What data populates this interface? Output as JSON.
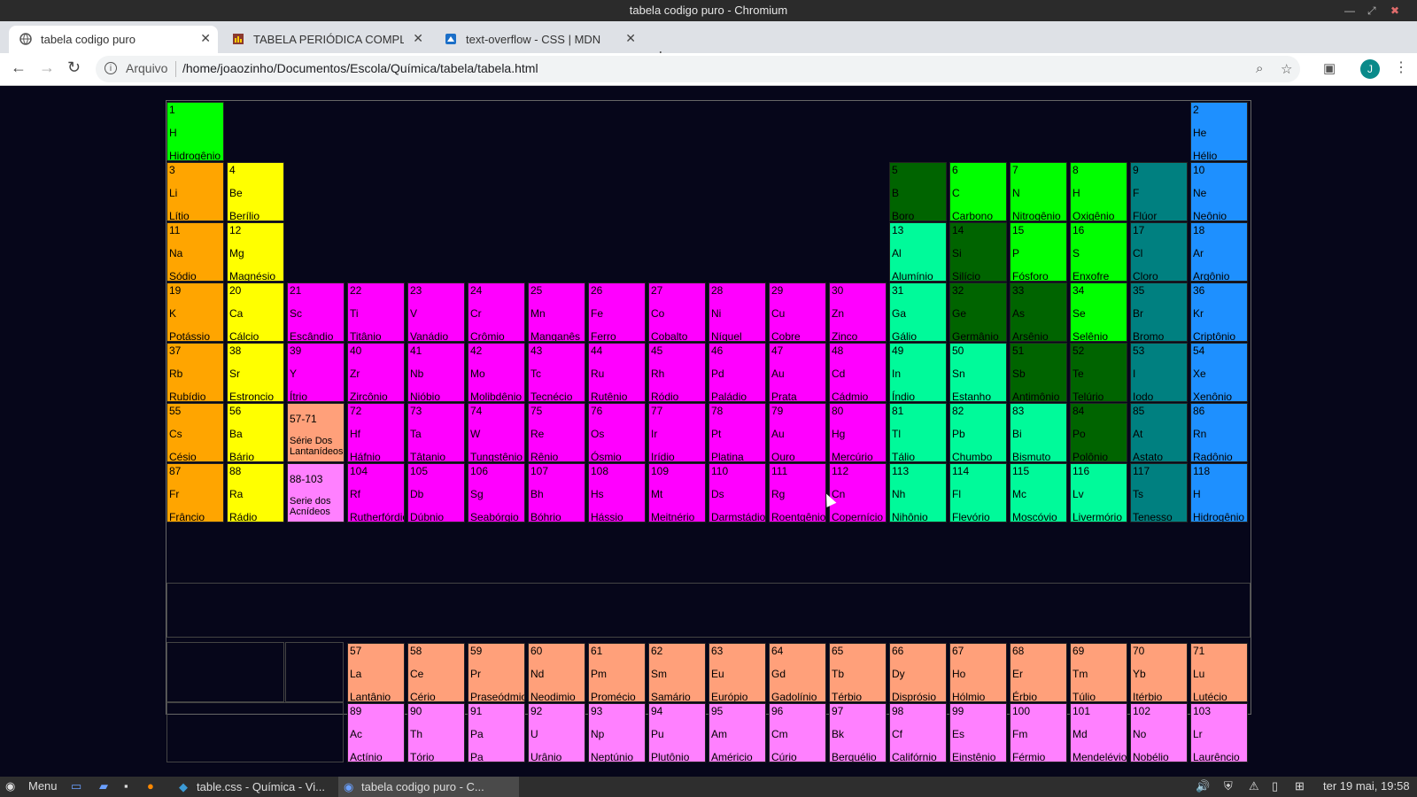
{
  "window": {
    "title": "tabela codigo puro - Chromium"
  },
  "tabs": [
    {
      "label": "tabela codigo puro",
      "icon": "globe-icon",
      "active": true
    },
    {
      "label": "TABELA PERIÓDICA COMPLET",
      "icon": "chart-icon",
      "active": false
    },
    {
      "label": "text-overflow - CSS | MDN",
      "icon": "mdn-icon",
      "active": false
    }
  ],
  "toolbar": {
    "origin": "Arquivo",
    "url": "/home/joaozinho/Documentos/Escola/Química/tabela/tabela.html",
    "avatar": "J"
  },
  "colors": {
    "alkali": "#ffa500",
    "alkaline": "#ffff00",
    "transition": "#ff00ff",
    "nonmetal": "#00ff00",
    "metalloid": "#006400",
    "poormetal": "#00fa9a",
    "halogen": "#008080",
    "noble": "#1e90ff",
    "lanthanide": "#ffa07a",
    "actinide": "#ff80ff",
    "hydrogen": "#00ff00"
  },
  "elements": [
    {
      "n": "1",
      "s": "H",
      "name": "Hidrogênio",
      "c": "nonmetal",
      "r": 1,
      "col": 1
    },
    {
      "n": "2",
      "s": "He",
      "name": "Hélio",
      "c": "noble",
      "r": 1,
      "col": 18
    },
    {
      "n": "3",
      "s": "Li",
      "name": "Lítio",
      "c": "alkali",
      "r": 2,
      "col": 1
    },
    {
      "n": "4",
      "s": "Be",
      "name": "Berílio",
      "c": "alkaline",
      "r": 2,
      "col": 2
    },
    {
      "n": "5",
      "s": "B",
      "name": "Boro",
      "c": "metalloid",
      "r": 2,
      "col": 13
    },
    {
      "n": "6",
      "s": "C",
      "name": "Carbono",
      "c": "nonmetal",
      "r": 2,
      "col": 14
    },
    {
      "n": "7",
      "s": "N",
      "name": "Nitrogênio",
      "c": "nonmetal",
      "r": 2,
      "col": 15
    },
    {
      "n": "8",
      "s": "H",
      "name": "Oxigênio",
      "c": "nonmetal",
      "r": 2,
      "col": 16
    },
    {
      "n": "9",
      "s": "F",
      "name": "Flúor",
      "c": "halogen",
      "r": 2,
      "col": 17
    },
    {
      "n": "10",
      "s": "Ne",
      "name": "Neônio",
      "c": "noble",
      "r": 2,
      "col": 18
    },
    {
      "n": "11",
      "s": "Na",
      "name": "Sódio",
      "c": "alkali",
      "r": 3,
      "col": 1
    },
    {
      "n": "12",
      "s": "Mg",
      "name": "Magnésio",
      "c": "alkaline",
      "r": 3,
      "col": 2
    },
    {
      "n": "13",
      "s": "Al",
      "name": "Alumínio",
      "c": "poormetal",
      "r": 3,
      "col": 13
    },
    {
      "n": "14",
      "s": "Si",
      "name": "Silício",
      "c": "metalloid",
      "r": 3,
      "col": 14
    },
    {
      "n": "15",
      "s": "P",
      "name": "Fósforo",
      "c": "nonmetal",
      "r": 3,
      "col": 15
    },
    {
      "n": "16",
      "s": "S",
      "name": "Enxofre",
      "c": "nonmetal",
      "r": 3,
      "col": 16
    },
    {
      "n": "17",
      "s": "Cl",
      "name": "Cloro",
      "c": "halogen",
      "r": 3,
      "col": 17
    },
    {
      "n": "18",
      "s": "Ar",
      "name": "Argônio",
      "c": "noble",
      "r": 3,
      "col": 18
    },
    {
      "n": "19",
      "s": "K",
      "name": "Potássio",
      "c": "alkali",
      "r": 4,
      "col": 1
    },
    {
      "n": "20",
      "s": "Ca",
      "name": "Cálcio",
      "c": "alkaline",
      "r": 4,
      "col": 2
    },
    {
      "n": "21",
      "s": "Sc",
      "name": "Escândio",
      "c": "transition",
      "r": 4,
      "col": 3
    },
    {
      "n": "22",
      "s": "Ti",
      "name": "Titânio",
      "c": "transition",
      "r": 4,
      "col": 4
    },
    {
      "n": "23",
      "s": "V",
      "name": "Vanádio",
      "c": "transition",
      "r": 4,
      "col": 5
    },
    {
      "n": "24",
      "s": "Cr",
      "name": "Crômio",
      "c": "transition",
      "r": 4,
      "col": 6
    },
    {
      "n": "25",
      "s": "Mn",
      "name": "Manganês",
      "c": "transition",
      "r": 4,
      "col": 7
    },
    {
      "n": "26",
      "s": "Fe",
      "name": "Ferro",
      "c": "transition",
      "r": 4,
      "col": 8
    },
    {
      "n": "27",
      "s": "Co",
      "name": "Cobalto",
      "c": "transition",
      "r": 4,
      "col": 9
    },
    {
      "n": "28",
      "s": "Ni",
      "name": "Níquel",
      "c": "transition",
      "r": 4,
      "col": 10
    },
    {
      "n": "29",
      "s": "Cu",
      "name": "Cobre",
      "c": "transition",
      "r": 4,
      "col": 11
    },
    {
      "n": "30",
      "s": "Zn",
      "name": "Zinco",
      "c": "transition",
      "r": 4,
      "col": 12
    },
    {
      "n": "31",
      "s": "Ga",
      "name": "Gálio",
      "c": "poormetal",
      "r": 4,
      "col": 13
    },
    {
      "n": "32",
      "s": "Ge",
      "name": "Germânio",
      "c": "metalloid",
      "r": 4,
      "col": 14
    },
    {
      "n": "33",
      "s": "As",
      "name": "Arsênio",
      "c": "metalloid",
      "r": 4,
      "col": 15
    },
    {
      "n": "34",
      "s": "Se",
      "name": "Selênio",
      "c": "nonmetal",
      "r": 4,
      "col": 16
    },
    {
      "n": "35",
      "s": "Br",
      "name": "Bromo",
      "c": "halogen",
      "r": 4,
      "col": 17
    },
    {
      "n": "36",
      "s": "Kr",
      "name": "Criptônio",
      "c": "noble",
      "r": 4,
      "col": 18
    },
    {
      "n": "37",
      "s": "Rb",
      "name": "Rubídio",
      "c": "alkali",
      "r": 5,
      "col": 1
    },
    {
      "n": "38",
      "s": "Sr",
      "name": "Estroncio",
      "c": "alkaline",
      "r": 5,
      "col": 2
    },
    {
      "n": "39",
      "s": "Y",
      "name": "Ítrio",
      "c": "transition",
      "r": 5,
      "col": 3
    },
    {
      "n": "40",
      "s": "Zr",
      "name": "Zircônio",
      "c": "transition",
      "r": 5,
      "col": 4
    },
    {
      "n": "41",
      "s": "Nb",
      "name": "Nióbio",
      "c": "transition",
      "r": 5,
      "col": 5
    },
    {
      "n": "42",
      "s": "Mo",
      "name": "Molibdênio",
      "c": "transition",
      "r": 5,
      "col": 6
    },
    {
      "n": "43",
      "s": "Tc",
      "name": "Tecnécio",
      "c": "transition",
      "r": 5,
      "col": 7
    },
    {
      "n": "44",
      "s": "Ru",
      "name": "Rutênio",
      "c": "transition",
      "r": 5,
      "col": 8
    },
    {
      "n": "45",
      "s": "Rh",
      "name": "Ródio",
      "c": "transition",
      "r": 5,
      "col": 9
    },
    {
      "n": "46",
      "s": "Pd",
      "name": "Paládio",
      "c": "transition",
      "r": 5,
      "col": 10
    },
    {
      "n": "47",
      "s": "Au",
      "name": "Prata",
      "c": "transition",
      "r": 5,
      "col": 11
    },
    {
      "n": "48",
      "s": "Cd",
      "name": "Cádmio",
      "c": "transition",
      "r": 5,
      "col": 12
    },
    {
      "n": "49",
      "s": "In",
      "name": "Índio",
      "c": "poormetal",
      "r": 5,
      "col": 13
    },
    {
      "n": "50",
      "s": "Sn",
      "name": "Estanho",
      "c": "poormetal",
      "r": 5,
      "col": 14
    },
    {
      "n": "51",
      "s": "Sb",
      "name": "Antimônio",
      "c": "metalloid",
      "r": 5,
      "col": 15
    },
    {
      "n": "52",
      "s": "Te",
      "name": "Telúrio",
      "c": "metalloid",
      "r": 5,
      "col": 16
    },
    {
      "n": "53",
      "s": "I",
      "name": "Iodo",
      "c": "halogen",
      "r": 5,
      "col": 17
    },
    {
      "n": "54",
      "s": "Xe",
      "name": "Xenônio",
      "c": "noble",
      "r": 5,
      "col": 18
    },
    {
      "n": "55",
      "s": "Cs",
      "name": "Césio",
      "c": "alkali",
      "r": 6,
      "col": 1
    },
    {
      "n": "56",
      "s": "Ba",
      "name": "Bário",
      "c": "alkaline",
      "r": 6,
      "col": 2
    },
    {
      "n": "57-71",
      "s": "",
      "name": "Série Dos Lantanídeos",
      "c": "lanthanide",
      "r": 6,
      "col": 3,
      "series": true
    },
    {
      "n": "72",
      "s": "Hf",
      "name": "Háfnio",
      "c": "transition",
      "r": 6,
      "col": 4
    },
    {
      "n": "73",
      "s": "Ta",
      "name": "Tâtanio",
      "c": "transition",
      "r": 6,
      "col": 5
    },
    {
      "n": "74",
      "s": "W",
      "name": "Tungstênio",
      "c": "transition",
      "r": 6,
      "col": 6
    },
    {
      "n": "75",
      "s": "Re",
      "name": "Rênio",
      "c": "transition",
      "r": 6,
      "col": 7
    },
    {
      "n": "76",
      "s": "Os",
      "name": "Ósmio",
      "c": "transition",
      "r": 6,
      "col": 8
    },
    {
      "n": "77",
      "s": "Ir",
      "name": "Irídio",
      "c": "transition",
      "r": 6,
      "col": 9
    },
    {
      "n": "78",
      "s": "Pt",
      "name": "Platina",
      "c": "transition",
      "r": 6,
      "col": 10
    },
    {
      "n": "79",
      "s": "Au",
      "name": "Ouro",
      "c": "transition",
      "r": 6,
      "col": 11
    },
    {
      "n": "80",
      "s": "Hg",
      "name": "Mercúrio",
      "c": "transition",
      "r": 6,
      "col": 12
    },
    {
      "n": "81",
      "s": "Tl",
      "name": "Tálio",
      "c": "poormetal",
      "r": 6,
      "col": 13
    },
    {
      "n": "82",
      "s": "Pb",
      "name": "Chumbo",
      "c": "poormetal",
      "r": 6,
      "col": 14
    },
    {
      "n": "83",
      "s": "Bi",
      "name": "Bismuto",
      "c": "poormetal",
      "r": 6,
      "col": 15
    },
    {
      "n": "84",
      "s": "Po",
      "name": "Polônio",
      "c": "metalloid",
      "r": 6,
      "col": 16
    },
    {
      "n": "85",
      "s": "At",
      "name": "Astato",
      "c": "halogen",
      "r": 6,
      "col": 17
    },
    {
      "n": "86",
      "s": "Rn",
      "name": "Radônio",
      "c": "noble",
      "r": 6,
      "col": 18
    },
    {
      "n": "87",
      "s": "Fr",
      "name": "Frâncio",
      "c": "alkali",
      "r": 7,
      "col": 1
    },
    {
      "n": "88",
      "s": "Ra",
      "name": "Rádio",
      "c": "alkaline",
      "r": 7,
      "col": 2
    },
    {
      "n": "88-103",
      "s": "",
      "name": "Serie dos Acnídeos",
      "c": "actinide",
      "r": 7,
      "col": 3,
      "series": true
    },
    {
      "n": "104",
      "s": "Rf",
      "name": "Rutherfórdio",
      "c": "transition",
      "r": 7,
      "col": 4
    },
    {
      "n": "105",
      "s": "Db",
      "name": "Dúbnio",
      "c": "transition",
      "r": 7,
      "col": 5
    },
    {
      "n": "106",
      "s": "Sg",
      "name": "Seabórgio",
      "c": "transition",
      "r": 7,
      "col": 6
    },
    {
      "n": "107",
      "s": "Bh",
      "name": "Bóhrio",
      "c": "transition",
      "r": 7,
      "col": 7
    },
    {
      "n": "108",
      "s": "Hs",
      "name": "Hássio",
      "c": "transition",
      "r": 7,
      "col": 8
    },
    {
      "n": "109",
      "s": "Mt",
      "name": "Meitnério",
      "c": "transition",
      "r": 7,
      "col": 9
    },
    {
      "n": "110",
      "s": "Ds",
      "name": "Darmstádio",
      "c": "transition",
      "r": 7,
      "col": 10
    },
    {
      "n": "111",
      "s": "Rg",
      "name": "Roentgênio",
      "c": "transition",
      "r": 7,
      "col": 11
    },
    {
      "n": "112",
      "s": "Cn",
      "name": "Copernício",
      "c": "transition",
      "r": 7,
      "col": 12
    },
    {
      "n": "113",
      "s": "Nh",
      "name": "Nihônio",
      "c": "poormetal",
      "r": 7,
      "col": 13
    },
    {
      "n": "114",
      "s": "Fl",
      "name": "Flevório",
      "c": "poormetal",
      "r": 7,
      "col": 14
    },
    {
      "n": "115",
      "s": "Mc",
      "name": "Moscóvio",
      "c": "poormetal",
      "r": 7,
      "col": 15
    },
    {
      "n": "116",
      "s": "Lv",
      "name": "Livermório",
      "c": "poormetal",
      "r": 7,
      "col": 16
    },
    {
      "n": "117",
      "s": "Ts",
      "name": "Tenesso",
      "c": "halogen",
      "r": 7,
      "col": 17
    },
    {
      "n": "118",
      "s": "H",
      "name": "Hidrogênio",
      "c": "noble",
      "r": 7,
      "col": 18
    },
    {
      "n": "57",
      "s": "La",
      "name": "Lantânio",
      "c": "lanthanide",
      "r": 9,
      "col": 4
    },
    {
      "n": "58",
      "s": "Ce",
      "name": "Cério",
      "c": "lanthanide",
      "r": 9,
      "col": 5
    },
    {
      "n": "59",
      "s": "Pr",
      "name": "Praseódmio",
      "c": "lanthanide",
      "r": 9,
      "col": 6
    },
    {
      "n": "60",
      "s": "Nd",
      "name": "Neodimio",
      "c": "lanthanide",
      "r": 9,
      "col": 7
    },
    {
      "n": "61",
      "s": "Pm",
      "name": "Promécio",
      "c": "lanthanide",
      "r": 9,
      "col": 8
    },
    {
      "n": "62",
      "s": "Sm",
      "name": "Samário",
      "c": "lanthanide",
      "r": 9,
      "col": 9
    },
    {
      "n": "63",
      "s": "Eu",
      "name": "Európio",
      "c": "lanthanide",
      "r": 9,
      "col": 10
    },
    {
      "n": "64",
      "s": "Gd",
      "name": "Gadolínio",
      "c": "lanthanide",
      "r": 9,
      "col": 11
    },
    {
      "n": "65",
      "s": "Tb",
      "name": "Térbio",
      "c": "lanthanide",
      "r": 9,
      "col": 12
    },
    {
      "n": "66",
      "s": "Dy",
      "name": "Disprósio",
      "c": "lanthanide",
      "r": 9,
      "col": 13
    },
    {
      "n": "67",
      "s": "Ho",
      "name": "Hólmio",
      "c": "lanthanide",
      "r": 9,
      "col": 14
    },
    {
      "n": "68",
      "s": "Er",
      "name": "Érbio",
      "c": "lanthanide",
      "r": 9,
      "col": 15
    },
    {
      "n": "69",
      "s": "Tm",
      "name": "Túlio",
      "c": "lanthanide",
      "r": 9,
      "col": 16
    },
    {
      "n": "70",
      "s": "Yb",
      "name": "Itérbio",
      "c": "lanthanide",
      "r": 9,
      "col": 17
    },
    {
      "n": "71",
      "s": "Lu",
      "name": "Lutécio",
      "c": "lanthanide",
      "r": 9,
      "col": 18
    },
    {
      "n": "89",
      "s": "Ac",
      "name": "Actínio",
      "c": "actinide",
      "r": 10,
      "col": 4
    },
    {
      "n": "90",
      "s": "Th",
      "name": "Tório",
      "c": "actinide",
      "r": 10,
      "col": 5
    },
    {
      "n": "91",
      "s": "Pa",
      "name": "Pa",
      "c": "actinide",
      "r": 10,
      "col": 6
    },
    {
      "n": "92",
      "s": "U",
      "name": "Urânio",
      "c": "actinide",
      "r": 10,
      "col": 7
    },
    {
      "n": "93",
      "s": "Np",
      "name": "Neptúnio",
      "c": "actinide",
      "r": 10,
      "col": 8
    },
    {
      "n": "94",
      "s": "Pu",
      "name": "Plutônio",
      "c": "actinide",
      "r": 10,
      "col": 9
    },
    {
      "n": "95",
      "s": "Am",
      "name": "Américio",
      "c": "actinide",
      "r": 10,
      "col": 10
    },
    {
      "n": "96",
      "s": "Cm",
      "name": "Cúrio",
      "c": "actinide",
      "r": 10,
      "col": 11
    },
    {
      "n": "97",
      "s": "Bk",
      "name": "Berquélio",
      "c": "actinide",
      "r": 10,
      "col": 12
    },
    {
      "n": "98",
      "s": "Cf",
      "name": "Califórnio",
      "c": "actinide",
      "r": 10,
      "col": 13
    },
    {
      "n": "99",
      "s": "Es",
      "name": "Einstênio",
      "c": "actinide",
      "r": 10,
      "col": 14
    },
    {
      "n": "100",
      "s": "Fm",
      "name": "Férmio",
      "c": "actinide",
      "r": 10,
      "col": 15
    },
    {
      "n": "101",
      "s": "Md",
      "name": "Mendelévio",
      "c": "actinide",
      "r": 10,
      "col": 16
    },
    {
      "n": "102",
      "s": "No",
      "name": "Nobélio",
      "c": "actinide",
      "r": 10,
      "col": 17
    },
    {
      "n": "103",
      "s": "Lr",
      "name": "Laurêncio",
      "c": "actinide",
      "r": 10,
      "col": 18
    }
  ],
  "taskbar": {
    "menu_label": "Menu",
    "tasks": [
      {
        "label": "table.css - Química - Vi...",
        "active": false
      },
      {
        "label": "tabela codigo puro - C...",
        "active": true
      }
    ],
    "clock": "ter 19 mai, 19:58"
  }
}
